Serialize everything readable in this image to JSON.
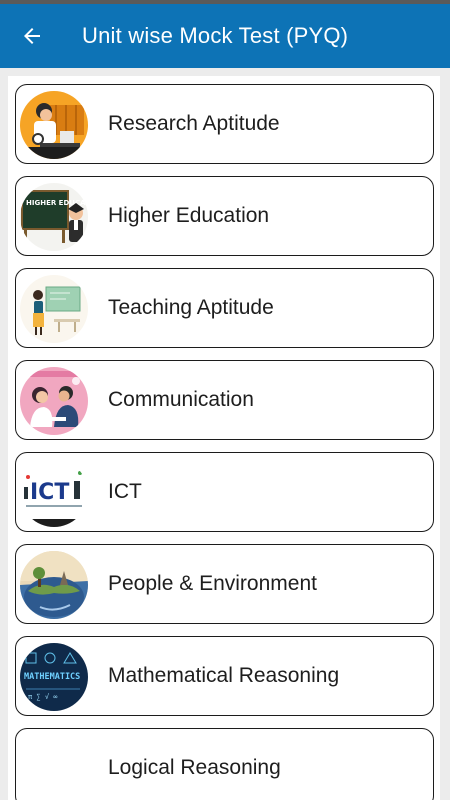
{
  "header": {
    "title": "Unit wise Mock Test (PYQ)",
    "back_icon": "arrow-left-icon",
    "background": "#0d73b6"
  },
  "units": [
    {
      "label": "Research Aptitude",
      "icon": "research-aptitude-illustration"
    },
    {
      "label": "Higher Education",
      "icon": "higher-education-illustration",
      "icon_text": "HIGHER EDUCATION"
    },
    {
      "label": "Teaching Aptitude",
      "icon": "teaching-aptitude-illustration"
    },
    {
      "label": "Communication",
      "icon": "communication-illustration"
    },
    {
      "label": "ICT",
      "icon": "ict-illustration",
      "icon_text": "ICT"
    },
    {
      "label": "People & Environment",
      "icon": "earth-illustration"
    },
    {
      "label": "Mathematical Reasoning",
      "icon": "mathematics-illustration",
      "icon_text": "MATHEMATICS"
    },
    {
      "label": "Logical Reasoning",
      "icon": null
    }
  ]
}
